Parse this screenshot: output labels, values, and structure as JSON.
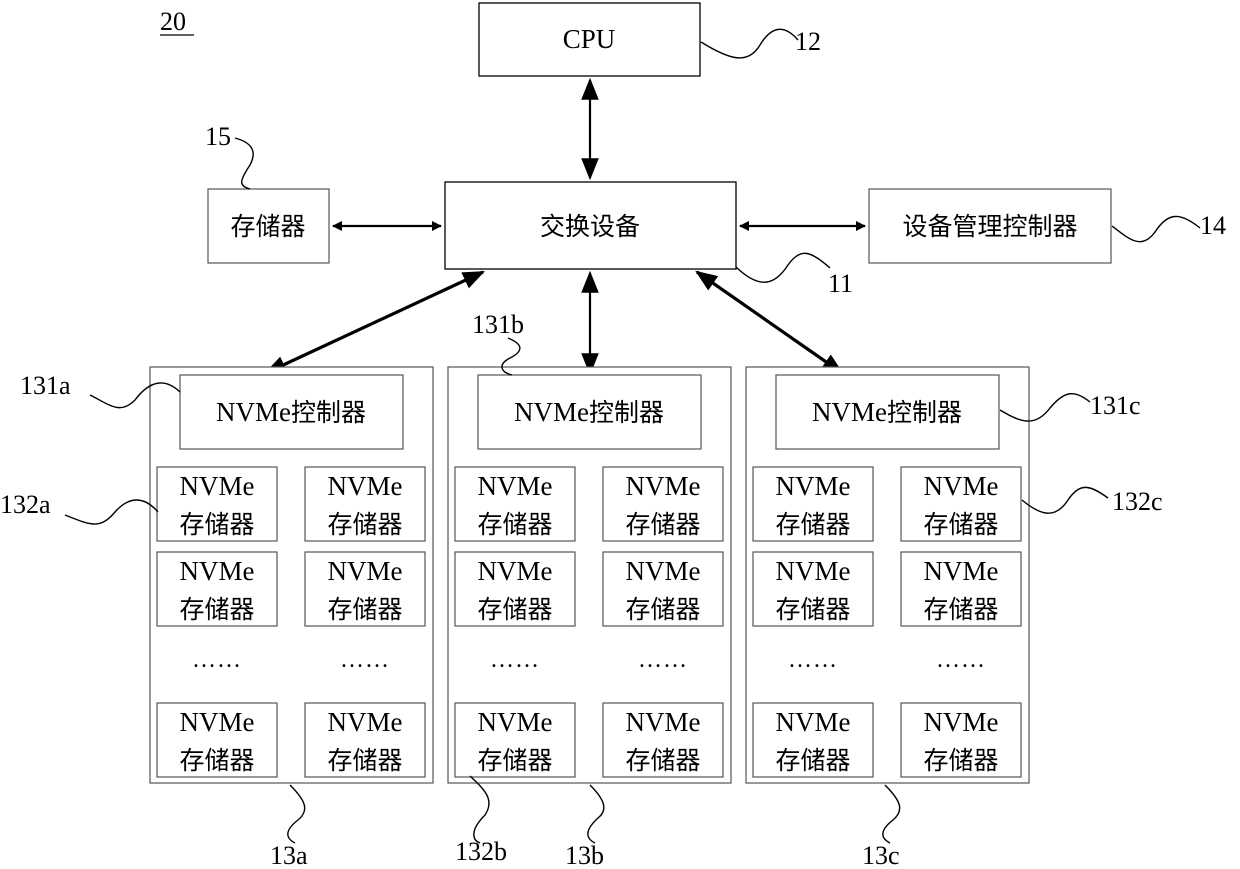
{
  "figure_label": "20",
  "cpu": {
    "label": "CPU",
    "ref": "12"
  },
  "switch": {
    "label": "交换设备",
    "ref": "11"
  },
  "memory": {
    "label": "存储器",
    "ref": "15"
  },
  "device_mgmt": {
    "label": "设备管理控制器",
    "ref": "14"
  },
  "groups": [
    {
      "ref": "13a",
      "controller": {
        "label_en": "NVMe",
        "label_zh": "控制器",
        "ref": "131a"
      },
      "storage_ref": "132a",
      "storage": {
        "line1": "NVMe",
        "line2": "存储器"
      },
      "ellipsis": "……"
    },
    {
      "ref": "13b",
      "controller": {
        "label_en": "NVMe",
        "label_zh": "控制器",
        "ref": "131b"
      },
      "storage_ref": "132b",
      "storage": {
        "line1": "NVMe",
        "line2": "存储器"
      },
      "ellipsis": "……"
    },
    {
      "ref": "13c",
      "controller": {
        "label_en": "NVMe",
        "label_zh": "控制器",
        "ref": "131c"
      },
      "storage_ref": "132c",
      "storage": {
        "line1": "NVMe",
        "line2": "存储器"
      },
      "ellipsis": "……"
    }
  ]
}
